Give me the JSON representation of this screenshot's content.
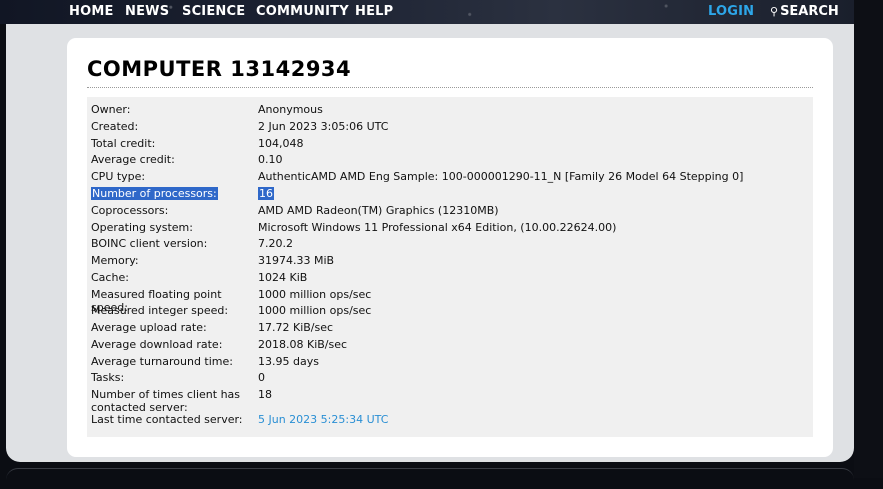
{
  "nav": {
    "home": "HOME",
    "news": "NEWS",
    "science": "SCIENCE",
    "community": "COMMUNITY",
    "help": "HELP",
    "login": "LOGIN",
    "search": "SEARCH",
    "search_icon": "magnifier-icon",
    "login_color": "#2da6e8"
  },
  "page": {
    "title": "COMPUTER 13142934"
  },
  "details": [
    {
      "label": "Owner:",
      "value": "Anonymous"
    },
    {
      "label": "Created:",
      "value": "2 Jun 2023 3:05:06 UTC"
    },
    {
      "label": "Total credit:",
      "value": "104,048"
    },
    {
      "label": "Average credit:",
      "value": "0.10"
    },
    {
      "label": "CPU type:",
      "value": "AuthenticAMD AMD Eng Sample: 100-000001290-11_N [Family 26 Model 64 Stepping 0]"
    },
    {
      "label": "Number of processors:",
      "value": "16"
    },
    {
      "label": "Coprocessors:",
      "value": "AMD AMD Radeon(TM) Graphics (12310MB)"
    },
    {
      "label": "Operating system:",
      "value": "Microsoft Windows 11 Professional x64 Edition, (10.00.22624.00)"
    },
    {
      "label": "BOINC client version:",
      "value": "7.20.2"
    },
    {
      "label": "Memory:",
      "value": "31974.33 MiB"
    },
    {
      "label": "Cache:",
      "value": "1024 KiB"
    },
    {
      "label": "Measured floating point speed:",
      "value": "1000 million ops/sec"
    },
    {
      "label": "Measured integer speed:",
      "value": "1000 million ops/sec"
    },
    {
      "label": "Average upload rate:",
      "value": "17.72 KiB/sec"
    },
    {
      "label": "Average download rate:",
      "value": "2018.08 KiB/sec"
    },
    {
      "label": "Average turnaround time:",
      "value": "13.95 days"
    },
    {
      "label": "Tasks:",
      "value": "0"
    },
    {
      "label": "Number of times client has contacted server:",
      "value": "18"
    },
    {
      "label": "Last time contacted server:",
      "value": "5 Jun 2023 5:25:34 UTC"
    }
  ],
  "colors": {
    "highlight": "#2f68c9",
    "link": "#2a8fd4"
  }
}
